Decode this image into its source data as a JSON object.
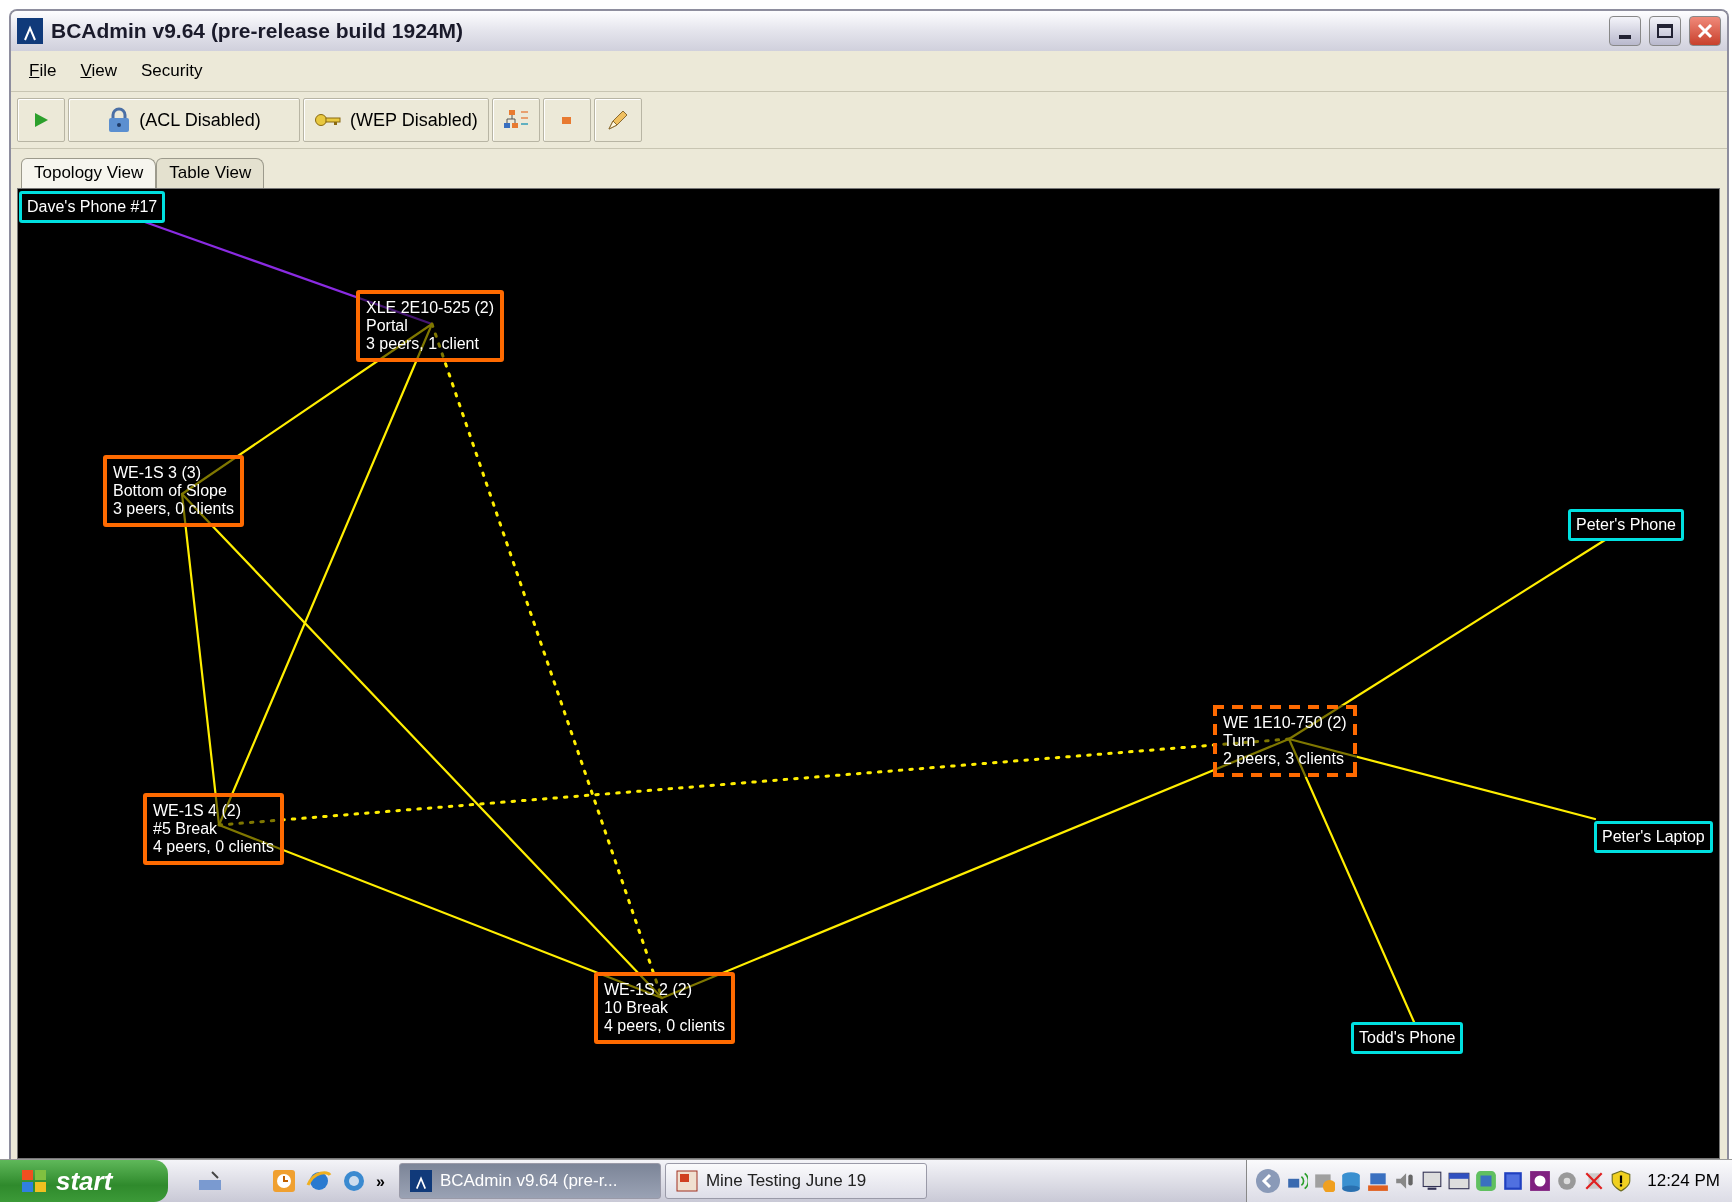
{
  "window": {
    "title": "BCAdmin v9.64 (pre-release build 1924M)"
  },
  "menu": [
    {
      "label": "File",
      "mnemonic": true
    },
    {
      "label": "View",
      "mnemonic": true
    },
    {
      "label": "Security",
      "mnemonic": false
    }
  ],
  "toolbar": [
    {
      "kind": "play"
    },
    {
      "kind": "lock",
      "label": "(ACL Disabled)"
    },
    {
      "kind": "key",
      "label": "(WEP Disabled)"
    },
    {
      "kind": "layout"
    },
    {
      "kind": "dot"
    },
    {
      "kind": "pen"
    }
  ],
  "tabs": [
    {
      "label": "Topology View",
      "selected": true
    },
    {
      "label": "Table View",
      "selected": false
    }
  ],
  "topology": {
    "nodes": [
      {
        "kind": "client",
        "selected": false,
        "lines": [
          "Dave's Phone #17"
        ]
      },
      {
        "kind": "access_point",
        "selected": false,
        "lines": [
          "XLE 2E10-525 (2)",
          "Portal",
          "3 peers, 1 client"
        ]
      },
      {
        "kind": "access_point",
        "selected": false,
        "lines": [
          "WE-1S 3 (3)",
          "Bottom of Slope",
          "3 peers, 0 clients"
        ]
      },
      {
        "kind": "client",
        "selected": false,
        "lines": [
          "Peter's Phone"
        ]
      },
      {
        "kind": "access_point",
        "selected": true,
        "lines": [
          "WE 1E10-750 (2)",
          "Turn",
          "2 peers, 3 clients"
        ]
      },
      {
        "kind": "access_point",
        "selected": false,
        "lines": [
          "WE-1S 4 (2)",
          "#5 Break",
          "4 peers, 0 clients"
        ]
      },
      {
        "kind": "client",
        "selected": false,
        "lines": [
          "Peter's Laptop"
        ]
      },
      {
        "kind": "access_point",
        "selected": false,
        "lines": [
          "WE-1S 2 (2)",
          "10 Break",
          "4 peers, 0 clients"
        ]
      },
      {
        "kind": "client",
        "selected": false,
        "lines": [
          "Todd's Phone"
        ]
      }
    ]
  },
  "taskbar": {
    "start": "start",
    "quick_launch_more": "»",
    "tasks": [
      {
        "label": "BCAdmin v9.64 (pre-r...",
        "selected": true
      },
      {
        "label": "Mine Testing June 19",
        "selected": false
      }
    ],
    "clock": "12:24 PM"
  }
}
